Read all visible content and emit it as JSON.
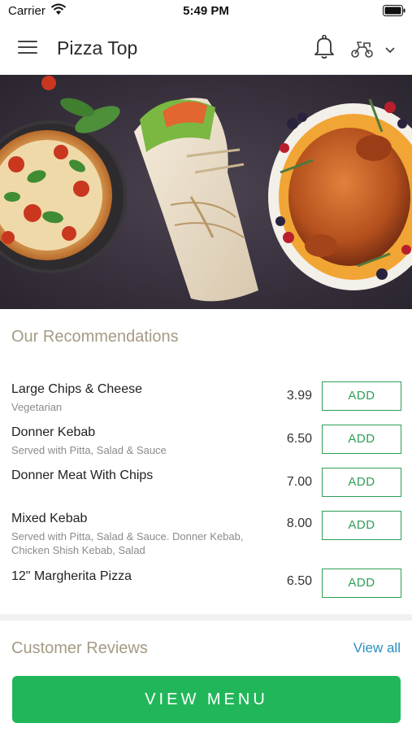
{
  "status_bar": {
    "carrier": "Carrier",
    "time": "5:49 PM",
    "icons": [
      "wifi-icon",
      "battery-icon"
    ]
  },
  "header": {
    "title": "Pizza Top",
    "icons": [
      "hamburger-menu-icon",
      "bell-icon",
      "scooter-icon",
      "chevron-down-icon"
    ]
  },
  "hero": {
    "description_icons": [
      "pizza",
      "wrap",
      "roast-chicken"
    ]
  },
  "recommendations": {
    "title": "Our Recommendations",
    "items": [
      {
        "name": "Large Chips & Cheese",
        "description": "Vegetarian",
        "price": "3.99",
        "add_label": "ADD"
      },
      {
        "name": "Donner Kebab",
        "description": "Served with Pitta, Salad & Sauce",
        "price": "6.50",
        "add_label": "ADD"
      },
      {
        "name": "Donner Meat With Chips",
        "description": "",
        "price": "7.00",
        "add_label": "ADD"
      },
      {
        "name": "Mixed Kebab",
        "description": "Served with Pitta, Salad & Sauce. Donner Kebab, Chicken Shish Kebab, Salad",
        "price": "8.00",
        "add_label": "ADD"
      },
      {
        "name": "12\" Margherita Pizza",
        "description": "",
        "price": "6.50",
        "add_label": "ADD"
      }
    ]
  },
  "reviews": {
    "title": "Customer Reviews",
    "view_all_label": "View all"
  },
  "footer": {
    "view_menu_label": "VIEW MENU"
  },
  "colors": {
    "accent_green": "#22b65a",
    "add_button_green": "#2e9e55",
    "section_title_tan": "#a59a84",
    "link_blue": "#2a8fc1"
  }
}
